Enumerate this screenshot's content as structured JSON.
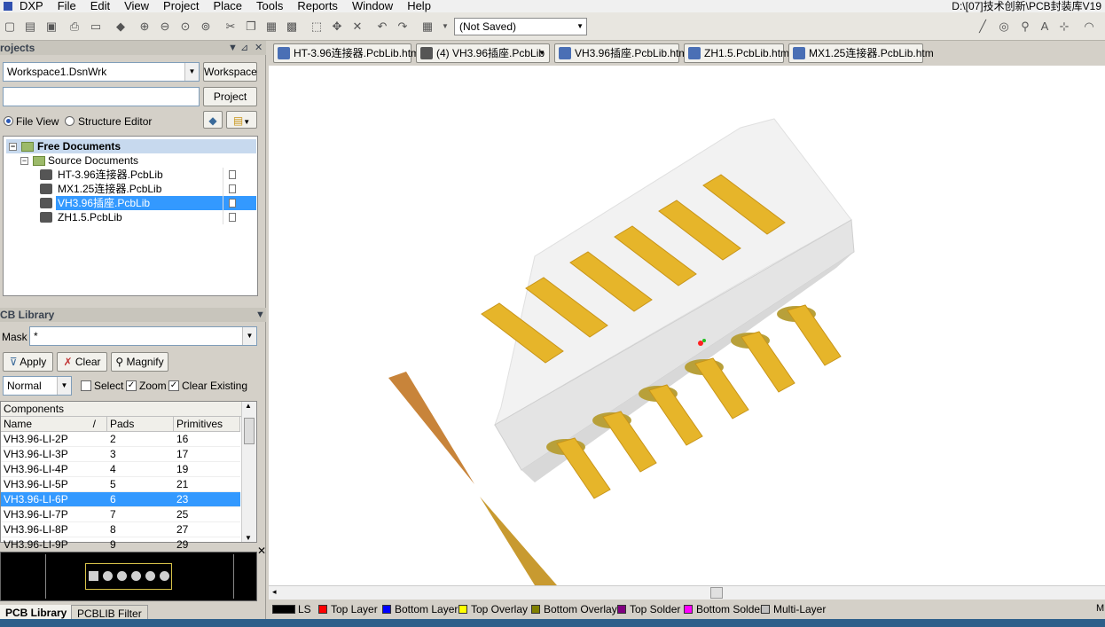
{
  "menu": {
    "items": [
      "DXP",
      "File",
      "Edit",
      "View",
      "Project",
      "Place",
      "Tools",
      "Reports",
      "Window",
      "Help"
    ],
    "path_title": "D:\\[07]技术创新\\PCB封装库V19"
  },
  "toolbar": {
    "not_saved": "(Not Saved)"
  },
  "projects_panel": {
    "title": "rojects",
    "workspace_value": "Workspace1.DsnWrk",
    "workspace_button": "Workspace",
    "project_button": "Project",
    "file_view": "File View",
    "structure_editor": "Structure Editor",
    "tree": {
      "free_documents": "Free Documents",
      "source_documents": "Source Documents",
      "files": [
        "HT-3.96连接器.PcbLib",
        "MX1.25连接器.PcbLib",
        "VH3.96插座.PcbLib",
        "ZH1.5.PcbLib"
      ],
      "selected_index": 2
    }
  },
  "pcb_library": {
    "title": "CB Library",
    "mask_label": "Mask",
    "mask_value": "*",
    "apply": "Apply",
    "clear": "Clear",
    "magnify": "Magnify",
    "mode": "Normal",
    "select": "Select",
    "zoom": "Zoom",
    "clear_existing": "Clear Existing",
    "components_header": "Components",
    "columns": [
      "Name",
      "/",
      "Pads",
      "Primitives"
    ],
    "rows": [
      {
        "name": "VH3.96-LI-2P",
        "pads": "2",
        "primitives": "16"
      },
      {
        "name": "VH3.96-LI-3P",
        "pads": "3",
        "primitives": "17"
      },
      {
        "name": "VH3.96-LI-4P",
        "pads": "4",
        "primitives": "19"
      },
      {
        "name": "VH3.96-LI-5P",
        "pads": "5",
        "primitives": "21"
      },
      {
        "name": "VH3.96-LI-6P",
        "pads": "6",
        "primitives": "23"
      },
      {
        "name": "VH3.96-LI-7P",
        "pads": "7",
        "primitives": "25"
      },
      {
        "name": "VH3.96-LI-8P",
        "pads": "8",
        "primitives": "27"
      },
      {
        "name": "VH3.96-LI-9P",
        "pads": "9",
        "primitives": "29"
      }
    ],
    "selected_row": 4
  },
  "bottom_tabs": [
    "PCB Library",
    "PCBLIB Filter"
  ],
  "doc_tabs": [
    {
      "label": "HT-3.96连接器.PcbLib.htm",
      "kind": "htm"
    },
    {
      "label": "(4) VH3.96插座.PcbLib",
      "kind": "pcb"
    },
    {
      "label": "VH3.96插座.PcbLib.htm",
      "kind": "htm"
    },
    {
      "label": "ZH1.5.PcbLib.htm",
      "kind": "htm"
    },
    {
      "label": "MX1.25连接器.PcbLib.htm",
      "kind": "htm"
    }
  ],
  "layers": [
    {
      "label": "LS",
      "color": "#000000"
    },
    {
      "label": "Top Layer",
      "color": "#ff0000"
    },
    {
      "label": "Bottom Layer",
      "color": "#0000ff"
    },
    {
      "label": "Top Overlay",
      "color": "#ffff00"
    },
    {
      "label": "Bottom Overlay",
      "color": "#808000"
    },
    {
      "label": "Top Solder",
      "color": "#800080"
    },
    {
      "label": "Bottom Solder",
      "color": "#ff00ff"
    },
    {
      "label": "Multi-Layer",
      "color": "#c0c0c0"
    }
  ],
  "status_right": "M",
  "colors": {
    "pin_gold": "#e6b52a",
    "pin_gold_dark": "#c8951a",
    "body": "#eeeeee",
    "selection": "#3399ff"
  }
}
